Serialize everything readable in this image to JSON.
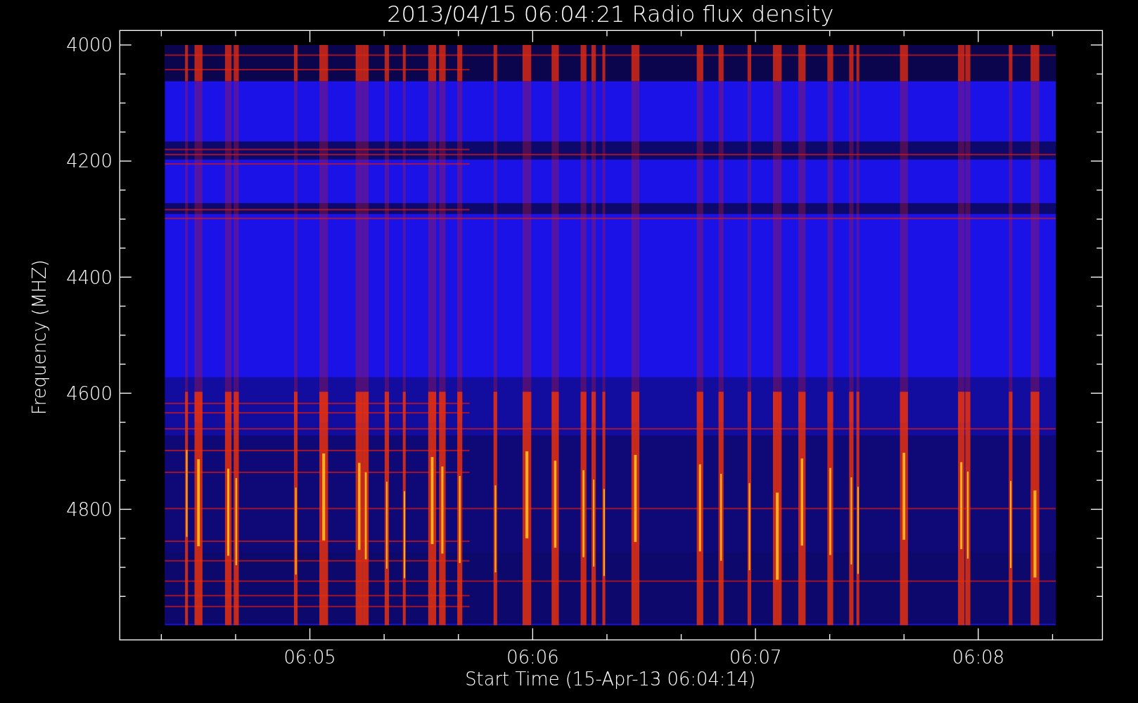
{
  "title": "2013/04/15 06:04:21 Radio flux density",
  "y_axis": {
    "label": "Frequency (MHZ)",
    "ticks": [
      "4000",
      "4200",
      "4400",
      "4600",
      "4800"
    ]
  },
  "x_axis": {
    "label": "Start Time (15-Apr-13 06:04:14)",
    "ticks": [
      "06:05",
      "06:06",
      "06:07",
      "06:08"
    ]
  }
}
